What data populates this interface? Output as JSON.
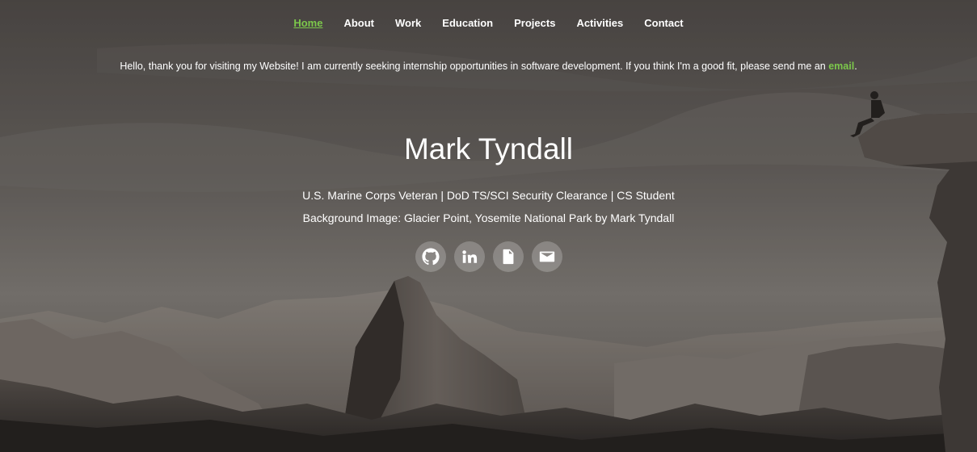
{
  "nav": {
    "items": [
      {
        "label": "Home",
        "active": true
      },
      {
        "label": "About"
      },
      {
        "label": "Work"
      },
      {
        "label": "Education"
      },
      {
        "label": "Projects"
      },
      {
        "label": "Activities"
      },
      {
        "label": "Contact"
      }
    ]
  },
  "notice": {
    "text": "Hello, thank you for visiting my Website! I am currently seeking internship opportunities in software development. If you think I'm a good fit, please send me an ",
    "link_label": "email",
    "end": "."
  },
  "hero": {
    "name": "Mark Tyndall",
    "tagline": "U.S. Marine Corps Veteran | DoD TS/SCI Security Clearance | CS Student",
    "credit": "Background Image: Glacier Point, Yosemite National Park by Mark Tyndall"
  },
  "social": [
    {
      "icon": "github-icon"
    },
    {
      "icon": "linkedin-icon"
    },
    {
      "icon": "document-icon"
    },
    {
      "icon": "mail-icon"
    }
  ],
  "colors": {
    "accent": "#7cc84b",
    "text": "#ffffff"
  }
}
